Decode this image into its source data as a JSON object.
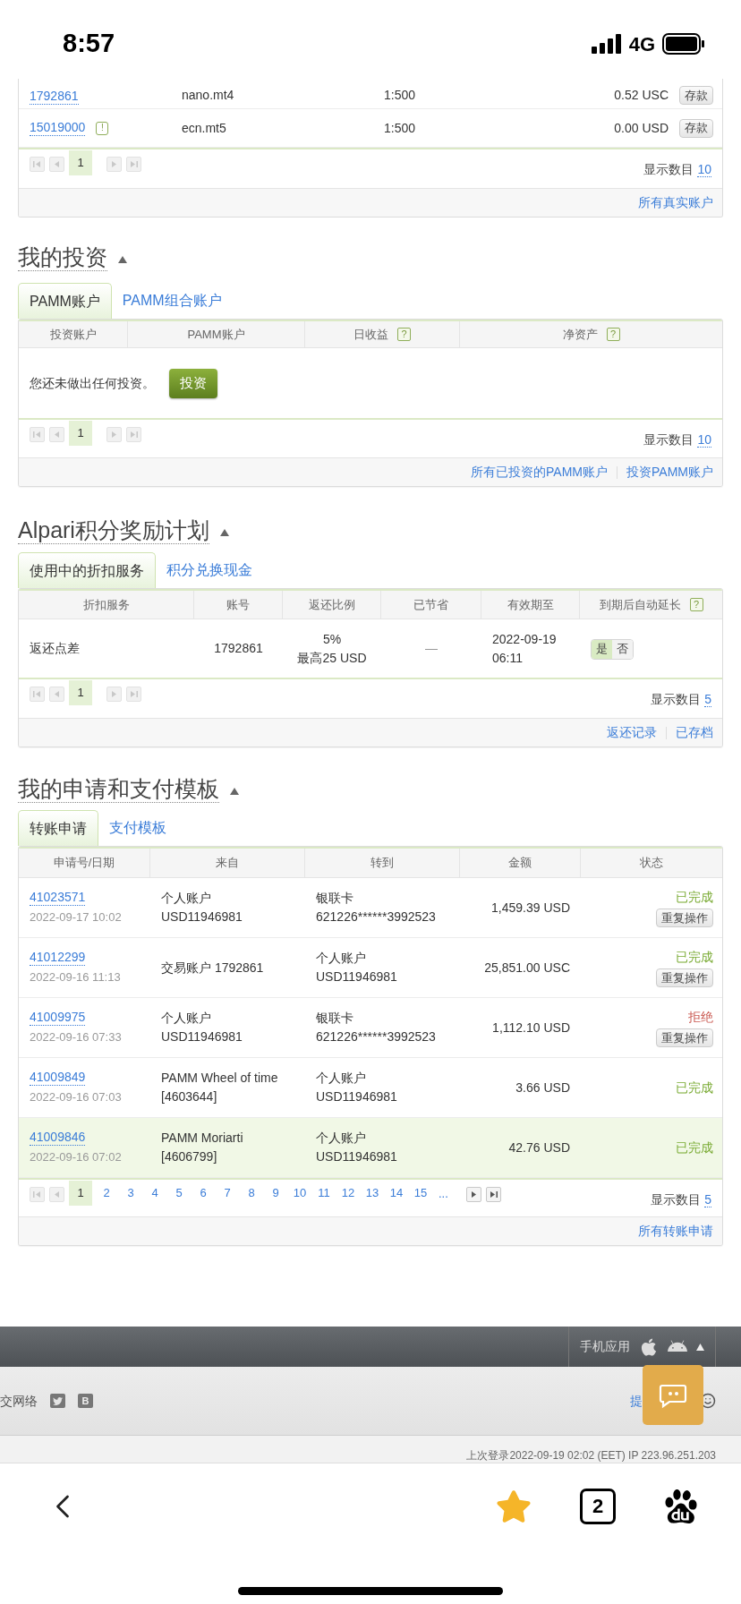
{
  "status_bar": {
    "time": "8:57",
    "network": "4G"
  },
  "accounts": {
    "rows": [
      {
        "account": "1792861",
        "badge": null,
        "type": "nano.mt4",
        "leverage": "1:500",
        "balance": "0.52 USC",
        "action": "存款"
      },
      {
        "account": "15019000",
        "badge": "!",
        "type": "ecn.mt5",
        "leverage": "1:500",
        "balance": "0.00 USD",
        "action": "存款"
      }
    ],
    "pager": {
      "prev_disabled": true,
      "next_disabled": true,
      "pages": [
        {
          "label": "1",
          "selected": true
        }
      ]
    },
    "page_size_label": "显示数目",
    "page_size": "10",
    "links": [
      "所有真实账户"
    ]
  },
  "investments": {
    "title": "我的投资",
    "tabs": [
      {
        "label": "PAMM账户",
        "selected": true
      },
      {
        "label": "PAMM组合账户",
        "selected": false
      }
    ],
    "columns": [
      {
        "label": "投资账户"
      },
      {
        "label": "PAMM账户"
      },
      {
        "label": "日收益",
        "help": "?"
      },
      {
        "label": "净资产",
        "help": "?"
      }
    ],
    "empty_text": "您还未做出任何投资。",
    "invest_button": "投资",
    "pager": {
      "prev_disabled": true,
      "next_disabled": true,
      "pages": [
        {
          "label": "1",
          "selected": true
        }
      ]
    },
    "page_size_label": "显示数目",
    "page_size": "10",
    "links": [
      "所有已投资的PAMM账户",
      "投资PAMM账户"
    ]
  },
  "bonus": {
    "title": "Alpari积分奖励计划",
    "tabs": [
      {
        "label": "使用中的折扣服务",
        "selected": true
      },
      {
        "label": "积分兑换现金",
        "selected": false
      }
    ],
    "columns": [
      {
        "label": "折扣服务"
      },
      {
        "label": "账号"
      },
      {
        "label": "返还比例"
      },
      {
        "label": "已节省"
      },
      {
        "label": "有效期至"
      },
      {
        "label": "到期后自动延长",
        "help": "?"
      }
    ],
    "rows": [
      {
        "service": "返还点差",
        "account": "1792861",
        "rate": [
          "5%",
          "最高25 USD"
        ],
        "saved": "—",
        "expires": [
          "2022-09-19",
          "06:11"
        ],
        "auto_extend": [
          {
            "label": "是",
            "selected": true
          },
          {
            "label": "否",
            "selected": false
          }
        ]
      }
    ],
    "pager": {
      "prev_disabled": true,
      "next_disabled": true,
      "pages": [
        {
          "label": "1",
          "selected": true
        }
      ]
    },
    "page_size_label": "显示数目",
    "page_size": "5",
    "links": [
      "返还记录",
      "已存档"
    ]
  },
  "requests": {
    "title": "我的申请和支付模板",
    "tabs": [
      {
        "label": "转账申请",
        "selected": true
      },
      {
        "label": "支付模板",
        "selected": false
      }
    ],
    "columns": [
      {
        "label": "申请号/日期"
      },
      {
        "label": "来自"
      },
      {
        "label": "转到"
      },
      {
        "label": "金额"
      },
      {
        "label": "状态"
      }
    ],
    "rows": [
      {
        "id": "41023571",
        "date": "2022-09-17 10:02",
        "from": [
          "个人账户",
          "USD11946981"
        ],
        "to": [
          "银联卡",
          "621226******3992523"
        ],
        "amount": "1,459.39 USD",
        "status": "已完成",
        "color": "#7aab34",
        "repeat": "重复操作",
        "highlighted": false
      },
      {
        "id": "41012299",
        "date": "2022-09-16 11:13",
        "from": [
          "交易账户 1792861"
        ],
        "to": [
          "个人账户",
          "USD11946981"
        ],
        "amount": "25,851.00 USC",
        "status": "已完成",
        "color": "#7aab34",
        "repeat": "重复操作",
        "highlighted": false
      },
      {
        "id": "41009975",
        "date": "2022-09-16 07:33",
        "from": [
          "个人账户",
          "USD11946981"
        ],
        "to": [
          "银联卡",
          "621226******3992523"
        ],
        "amount": "1,112.10 USD",
        "status": "拒绝",
        "color": "#c9574f",
        "repeat": "重复操作",
        "highlighted": false
      },
      {
        "id": "41009849",
        "date": "2022-09-16 07:03",
        "from": [
          "PAMM Wheel of time",
          "[4603644]"
        ],
        "to": [
          "个人账户",
          "USD11946981"
        ],
        "amount": "3.66 USD",
        "status": "已完成",
        "color": "#7aab34",
        "highlighted": false
      },
      {
        "id": "41009846",
        "date": "2022-09-16 07:02",
        "from": [
          "PAMM Moriarti",
          "[4606799]"
        ],
        "to": [
          "个人账户",
          "USD11946981"
        ],
        "amount": "42.76 USD",
        "status": "已完成",
        "color": "#7aab34",
        "highlighted": true
      }
    ],
    "pager": {
      "prev_disabled": true,
      "next_disabled": false,
      "pages": [
        {
          "label": "1",
          "selected": true
        },
        {
          "label": "2",
          "selected": false
        },
        {
          "label": "3",
          "selected": false
        },
        {
          "label": "4",
          "selected": false
        },
        {
          "label": "5",
          "selected": false
        },
        {
          "label": "6",
          "selected": false
        },
        {
          "label": "7",
          "selected": false
        },
        {
          "label": "8",
          "selected": false
        },
        {
          "label": "9",
          "selected": false
        },
        {
          "label": "10",
          "selected": false
        },
        {
          "label": "11",
          "selected": false
        },
        {
          "label": "12",
          "selected": false
        },
        {
          "label": "13",
          "selected": false
        },
        {
          "label": "14",
          "selected": false
        },
        {
          "label": "15",
          "selected": false
        }
      ],
      "ellipsis": "..."
    },
    "page_size_label": "显示数目",
    "page_size": "5",
    "links": [
      "所有转账申请"
    ]
  },
  "footer": {
    "apps_label": "手机应用",
    "social_label": "交网络",
    "social_icons": [
      {
        "kind": "twitter"
      },
      {
        "kind": "letter",
        "label": "B"
      }
    ],
    "help_link": "提",
    "last_login": "上次登录2022-09-19 02:02 (EET) IP 223.96.251.203"
  },
  "browser_bar": {
    "tab_count": "2"
  }
}
